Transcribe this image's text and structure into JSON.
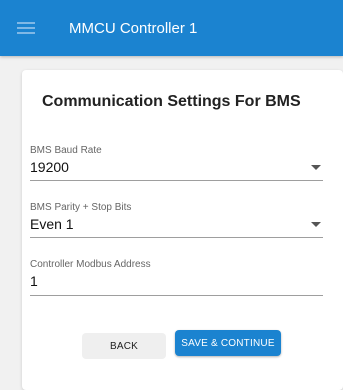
{
  "header": {
    "title": "MMCU Controller 1",
    "menu_icon": "hamburger-menu-icon"
  },
  "form": {
    "title": "Communication Settings For BMS",
    "fields": [
      {
        "label": "BMS Baud Rate",
        "value": "19200",
        "type": "select"
      },
      {
        "label": "BMS Parity + Stop Bits",
        "value": "Even 1",
        "type": "select"
      },
      {
        "label": "Controller Modbus Address",
        "value": "1",
        "type": "input"
      }
    ]
  },
  "actions": {
    "back_label": "BACK",
    "save_label": "SAVE & CONTINUE"
  },
  "colors": {
    "primary": "#1b83d0",
    "background": "#f1f1f1"
  }
}
